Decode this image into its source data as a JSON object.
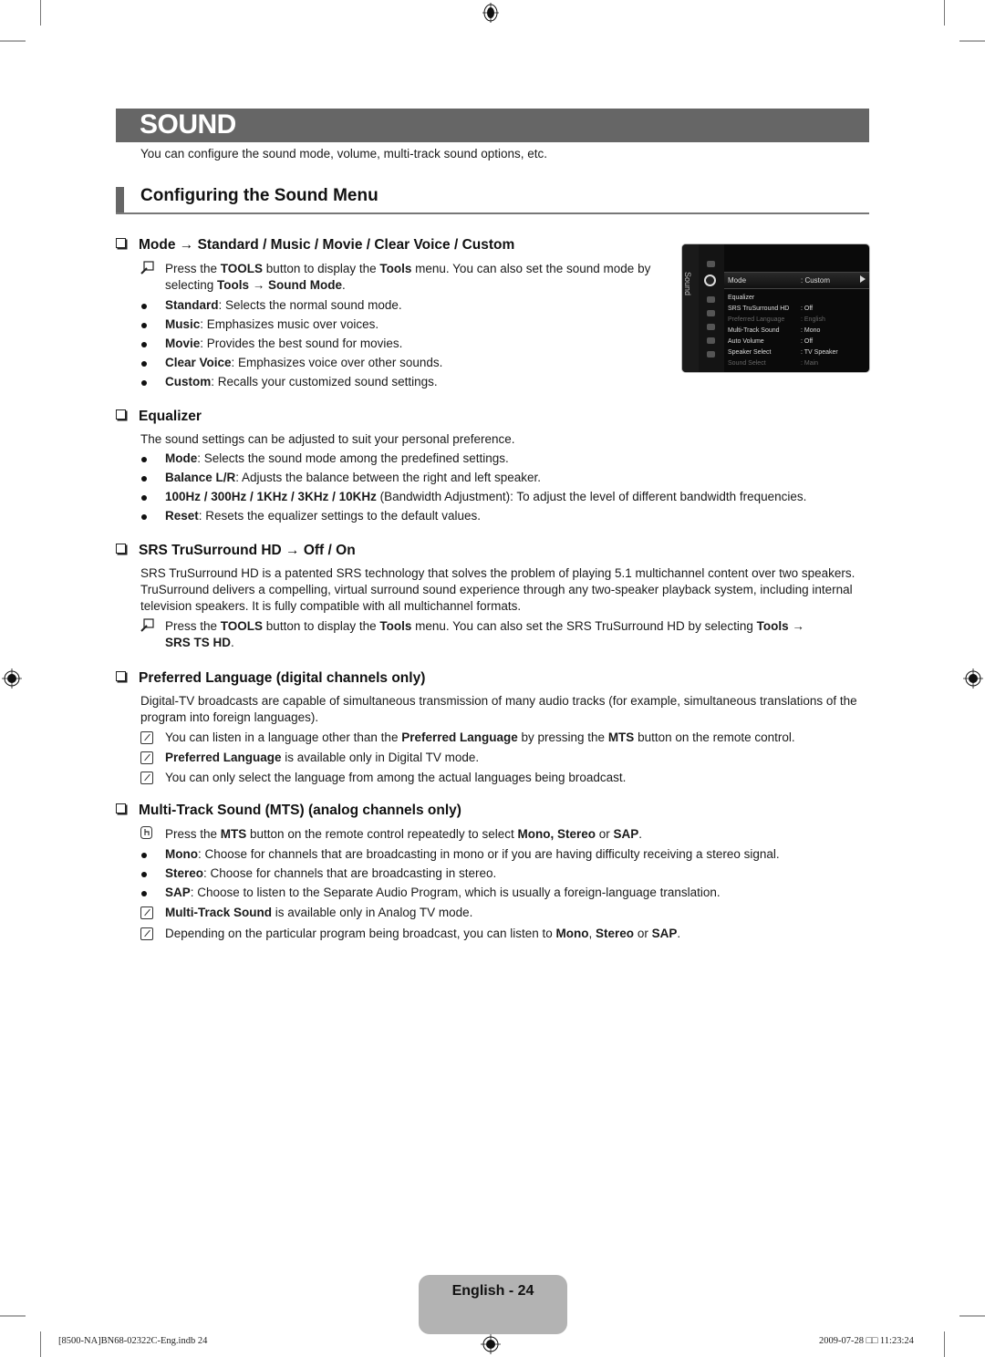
{
  "header": {
    "title": "SOUND",
    "intro": "You can configure the sound mode, volume, multi-track sound options, etc."
  },
  "section": {
    "title": "Configuring the Sound Menu"
  },
  "mode": {
    "heading": "Mode → Standard / Music / Movie / Clear Voice / Custom",
    "tools_note": {
      "p1": "Press the ",
      "b1": "TOOLS",
      "p2": " button to display the ",
      "b2": "Tools",
      "p3": " menu. You can also set the sound mode by",
      "p4": "selecting ",
      "b3": "Tools → Sound Mode",
      "p5": "."
    },
    "items": [
      {
        "term": "Standard",
        "desc": ": Selects the normal sound mode."
      },
      {
        "term": "Music",
        "desc": ": Emphasizes music over voices."
      },
      {
        "term": "Movie",
        "desc": ": Provides the best sound for movies."
      },
      {
        "term": "Clear Voice",
        "desc": ": Emphasizes voice over other sounds."
      },
      {
        "term": "Custom",
        "desc": ": Recalls your customized sound settings."
      }
    ]
  },
  "tv_menu": {
    "side_label": "Sound",
    "rows": [
      {
        "label": "Mode",
        "value": ": Custom",
        "state": "selected"
      },
      {
        "label": "Equalizer",
        "value": "",
        "state": "normal"
      },
      {
        "label": "SRS TruSurround HD",
        "value": ": Off",
        "state": "normal"
      },
      {
        "label": "Preferred Language",
        "value": ": English",
        "state": "dim"
      },
      {
        "label": "Multi-Track Sound",
        "value": ": Mono",
        "state": "normal"
      },
      {
        "label": "Auto Volume",
        "value": ": Off",
        "state": "normal"
      },
      {
        "label": "Speaker Select",
        "value": ": TV Speaker",
        "state": "normal"
      },
      {
        "label": "Sound Select",
        "value": ": Main",
        "state": "dim"
      }
    ]
  },
  "equalizer": {
    "heading": "Equalizer",
    "intro": "The sound settings can be adjusted to suit your personal preference.",
    "items": [
      {
        "term": "Mode",
        "desc": ": Selects the sound mode among the predefined settings."
      },
      {
        "term": "Balance L/R",
        "desc": ": Adjusts the balance between the right and left speaker."
      },
      {
        "term": "100Hz / 300Hz / 1KHz / 3KHz / 10KHz",
        "desc": " (Bandwidth Adjustment): To adjust the level of different bandwidth frequencies."
      },
      {
        "term": "Reset",
        "desc": ": Resets the equalizer settings to the default values."
      }
    ]
  },
  "srs": {
    "heading": "SRS TruSurround HD → Off / On",
    "body": "SRS TruSurround HD is a patented SRS technology that solves the problem of playing 5.1 multichannel content over two speakers. TruSurround delivers a compelling, virtual surround sound experience through any two-speaker playback system, including internal television speakers. It is fully compatible with all multichannel formats.",
    "tools_note": {
      "p1": "Press the ",
      "b1": "TOOLS",
      "p2": " button to display the ",
      "b2": "Tools",
      "p3": " menu. You can also set the SRS TruSurround HD by selecting ",
      "b3": "Tools →",
      "b4": "SRS TS HD",
      "p4": "."
    }
  },
  "preferred_language": {
    "heading": "Preferred Language (digital channels only)",
    "body": "Digital-TV broadcasts are capable of simultaneous transmission of many audio tracks (for example, simultaneous translations of the program into foreign languages).",
    "notes": [
      {
        "p1": "You can listen in a language other than the ",
        "b1": "Preferred Language",
        "p2": " by pressing the ",
        "b2": "MTS",
        "p3": " button on the remote control."
      },
      {
        "b1": "Preferred Language",
        "p1": " is available only in Digital TV mode."
      },
      {
        "p1": "You can only select the language from among the actual languages being broadcast."
      }
    ]
  },
  "mts": {
    "heading": "Multi-Track Sound (MTS) (analog channels only)",
    "remote_note": {
      "p1": "Press the ",
      "b1": "MTS",
      "p2": " button on the remote control repeatedly to select ",
      "b2": "Mono, Stereo",
      "p3": " or ",
      "b3": "SAP",
      "p4": "."
    },
    "items": [
      {
        "term": "Mono",
        "desc": ": Choose for channels that are broadcasting in mono or if you are having difficulty receiving a stereo signal."
      },
      {
        "term": "Stereo",
        "desc": ": Choose for channels that are broadcasting in stereo."
      },
      {
        "term": "SAP",
        "desc": ": Choose to listen to the Separate Audio Program, which is usually a foreign-language translation."
      }
    ],
    "notes": [
      {
        "b1": "Multi-Track Sound",
        "p1": " is available only in Analog TV mode."
      },
      {
        "p1": "Depending on the particular program being broadcast, you can listen to ",
        "b1": "Mono",
        "p2": ", ",
        "b2": "Stereo",
        "p3": " or ",
        "b3": "SAP",
        "p4": "."
      }
    ]
  },
  "footer": {
    "page_label": "English - 24",
    "file_slug": "[8500-NA]BN68-02322C-Eng.indb   24",
    "timestamp": "2009-07-28   □□ 11:23:24"
  }
}
